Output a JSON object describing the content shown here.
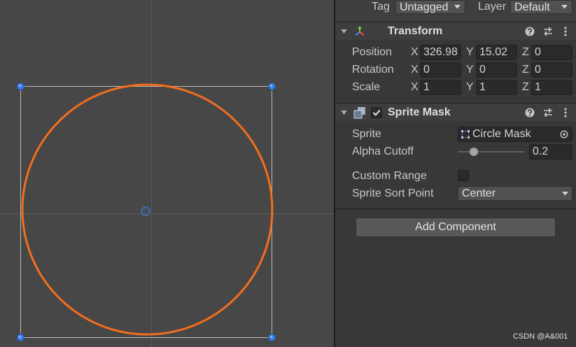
{
  "top_bar": {
    "tag_label": "Tag",
    "tag_value": "Untagged",
    "layer_label": "Layer",
    "layer_value": "Default"
  },
  "transform": {
    "title": "Transform",
    "expanded": true,
    "axis_labels": {
      "x": "X",
      "y": "Y",
      "z": "Z"
    },
    "rows": [
      {
        "label": "Position",
        "x": "326.98",
        "y": "15.02",
        "z": "0"
      },
      {
        "label": "Rotation",
        "x": "0",
        "y": "0",
        "z": "0"
      },
      {
        "label": "Scale",
        "x": "1",
        "y": "1",
        "z": "1"
      }
    ]
  },
  "sprite_mask": {
    "title": "Sprite Mask",
    "enabled": true,
    "expanded": true,
    "sprite_label": "Sprite",
    "sprite_value": "Circle Mask",
    "alpha_cutoff_label": "Alpha Cutoff",
    "alpha_cutoff_value": "0.2",
    "custom_range_label": "Custom Range",
    "custom_range": false,
    "sort_point_label": "Sprite Sort Point",
    "sort_point_value": "Center"
  },
  "add_component_label": "Add Component",
  "watermark": "CSDN @A&001",
  "icons": [
    "transform-icon",
    "sprite-mask-icon",
    "help-icon",
    "preset-icon",
    "kebab-menu-icon",
    "foldout-arrow-icon",
    "dropdown-arrow-icon",
    "sprite-asset-icon",
    "object-picker-icon",
    "checkmark-icon"
  ],
  "colors": {
    "scene_bg": "#474747",
    "inspector_bg": "#383838",
    "mask_outline": "#f36e1c",
    "handle": "#3c7fea"
  }
}
